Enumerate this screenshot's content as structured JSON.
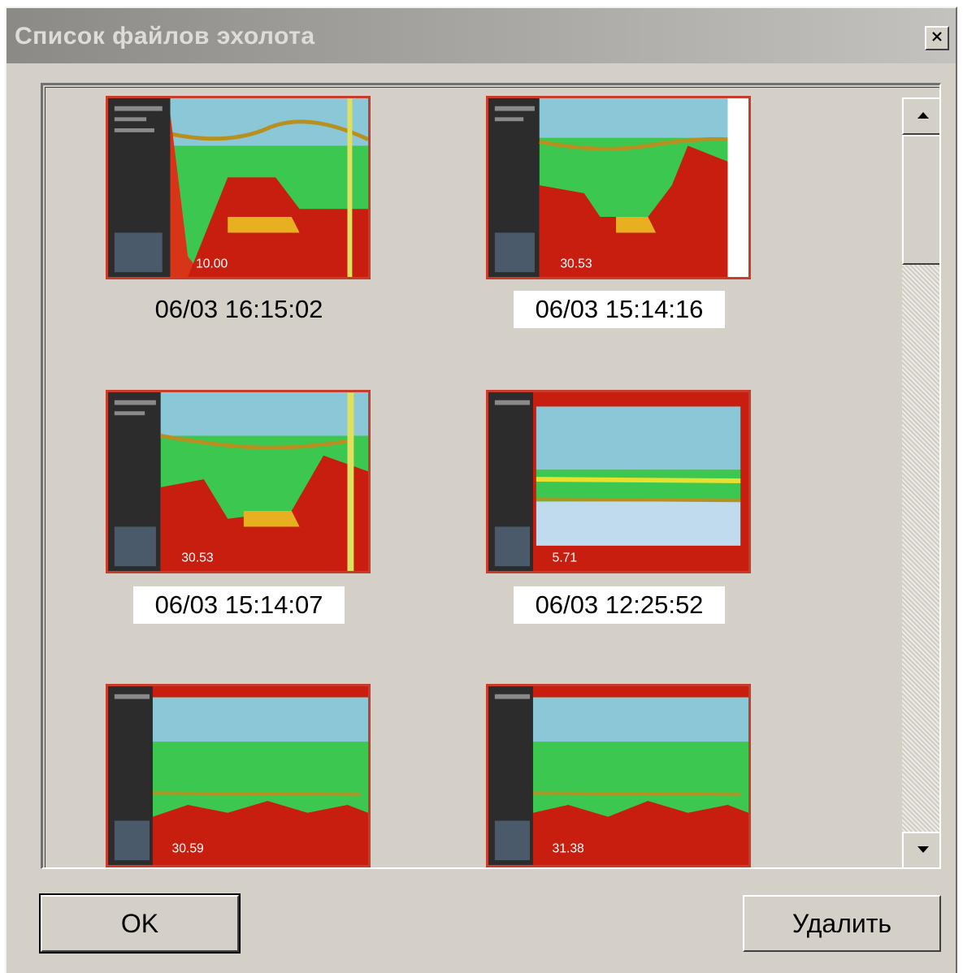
{
  "window": {
    "title": "Список файлов эхолота",
    "close_icon": "close-icon"
  },
  "files": [
    {
      "timestamp": "06/03 16:15:02",
      "selected": false,
      "overlay": "10.00"
    },
    {
      "timestamp": "06/03 15:14:16",
      "selected": true,
      "overlay": "30.53"
    },
    {
      "timestamp": "06/03 15:14:07",
      "selected": true,
      "overlay": "30.53"
    },
    {
      "timestamp": "06/03 12:25:52",
      "selected": true,
      "overlay": "5.71"
    },
    {
      "timestamp": "",
      "selected": false,
      "overlay": "30.59"
    },
    {
      "timestamp": "",
      "selected": false,
      "overlay": "31.38"
    }
  ],
  "scrollbar": {
    "up_icon": "arrow-up-icon",
    "down_icon": "arrow-down-icon"
  },
  "buttons": {
    "ok_label": "OK",
    "delete_label": "Удалить"
  },
  "colors": {
    "selection_bg": "#ffffff",
    "thumb_border": "#c83c2c",
    "echo_red": "#c81e10",
    "echo_green": "#3cc850",
    "echo_blue": "#a8cde0"
  }
}
